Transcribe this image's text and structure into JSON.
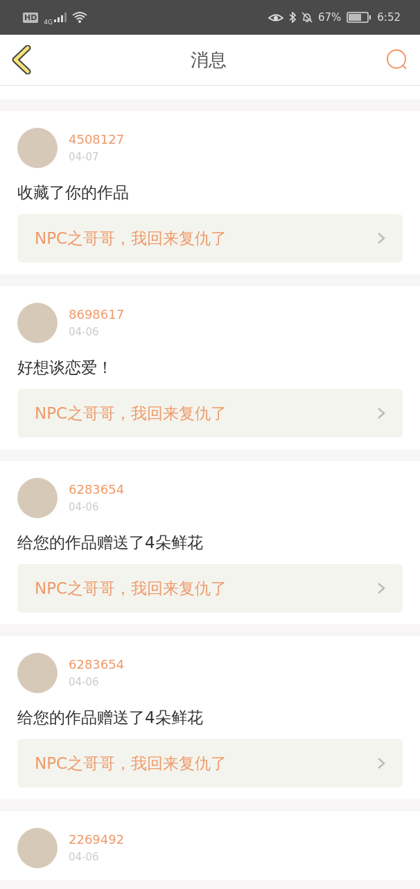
{
  "status_bar": {
    "network_badge": "HD",
    "network_type": "4G",
    "battery": "67%",
    "time": "6:52"
  },
  "header": {
    "title": "消息"
  },
  "messages": [
    {
      "user": "4508127",
      "date": "04-07",
      "text": "收藏了你的作品",
      "work": "NPC之哥哥，我回来复仇了"
    },
    {
      "user": "8698617",
      "date": "04-06",
      "text": "好想谈恋爱！",
      "work": "NPC之哥哥，我回来复仇了"
    },
    {
      "user": "6283654",
      "date": "04-06",
      "text": "给您的作品赠送了4朵鲜花",
      "work": "NPC之哥哥，我回来复仇了"
    },
    {
      "user": "6283654",
      "date": "04-06",
      "text": "给您的作品赠送了4朵鲜花",
      "work": "NPC之哥哥，我回来复仇了"
    },
    {
      "user": "2269492",
      "date": "04-06"
    }
  ]
}
